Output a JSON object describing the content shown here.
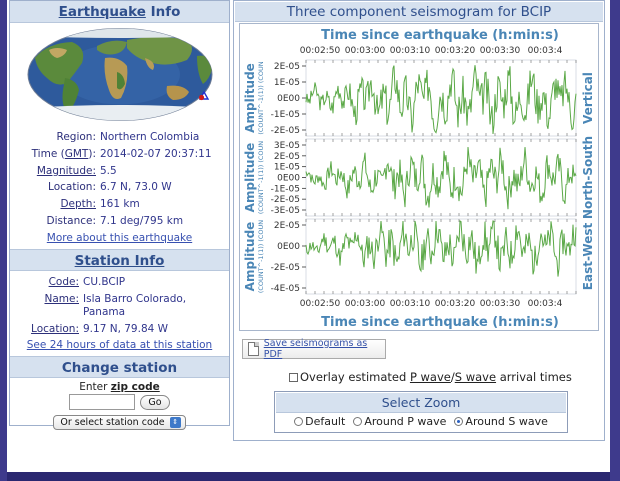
{
  "earthquake_info": {
    "header_link": "Earthquake",
    "header_rest": "Info",
    "rows": [
      {
        "label": "Region:",
        "value": "Northern Colombia"
      },
      {
        "label_pre": "Time (",
        "label_link": "GMT",
        "label_post": "):",
        "value": "2014-02-07 20:37:11"
      },
      {
        "label": "Magnitude:",
        "value": "5.5"
      },
      {
        "label": "Location:",
        "value": "6.7 N, 73.0 W"
      },
      {
        "label": "Depth:",
        "value": "161 km"
      },
      {
        "label": "Distance:",
        "value": "7.1 deg/795 km"
      }
    ],
    "more_link": "More about this earthquake"
  },
  "station_info": {
    "header": "Station Info",
    "rows": [
      {
        "label": "Code:",
        "value": "CU.BCIP"
      },
      {
        "label": "Name:",
        "value": "Isla Barro Colorado,\nPanama"
      },
      {
        "label": "Location:",
        "value": "9.17 N, 79.84 W"
      }
    ],
    "data_link": "See 24 hours of data at this station"
  },
  "change_station": {
    "header": "Change station",
    "zip_prefix": "Enter",
    "zip_link": "zip code",
    "go_button": "Go",
    "select_label": "Or select station code"
  },
  "seismogram": {
    "header": "Three component seismogram for BCIP",
    "x_axis_title": "Time since earthquake (h:min:s)",
    "x_ticks": [
      "00:02:50",
      "00:03:00",
      "00:03:10",
      "00:03:20",
      "00:03:30",
      "00:03:4"
    ],
    "y_title": "Amplitude",
    "y_subtitle": "(COUNT^-1(1)) (COUN",
    "line_color": "#5aa846",
    "text_color": "#4a86b6",
    "panels": [
      {
        "component": "Vertical",
        "ticks": [
          "2E-05",
          "1E-05",
          "0E00",
          "-1E-05",
          "-2E-05"
        ],
        "seed": 3,
        "amp": 1.0
      },
      {
        "component": "North-South",
        "ticks": [
          "3E-05",
          "2E-05",
          "1E-05",
          "0E00",
          "-1E-05",
          "-2E-05",
          "-3E-05"
        ],
        "seed": 7,
        "amp": 0.85
      },
      {
        "component": "East-West",
        "ticks": [
          "2E-05",
          "0E00",
          "-2E-05",
          "-4E-05"
        ],
        "seed": 11,
        "amp": 0.9
      }
    ]
  },
  "controls": {
    "pdf_button": "Save seismograms as PDF",
    "overlay_pre": "Overlay estimated",
    "overlay_p": "P wave",
    "overlay_sep": "/",
    "overlay_s": "S wave",
    "overlay_post": "arrival times",
    "zoom_header": "Select Zoom",
    "zoom_options": [
      "Default",
      "Around P wave",
      "Around S wave"
    ],
    "zoom_selected": 2
  }
}
